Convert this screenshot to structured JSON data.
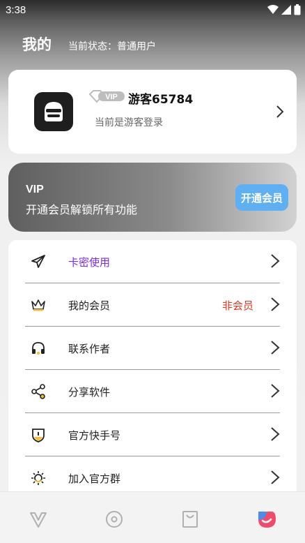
{
  "status_bar": {
    "time": "3:38"
  },
  "header": {
    "title": "我的",
    "status": "当前状态：普通用户"
  },
  "profile": {
    "vip_badge": "VIP",
    "username": "游客65784",
    "login_hint": "当前是游客登录"
  },
  "vip_banner": {
    "title": "VIP",
    "desc": "开通会员解锁所有功能",
    "button": "开通会员"
  },
  "menu": {
    "items": [
      {
        "label": "卡密使用",
        "icon": "paper-plane-icon",
        "highlight": "#7a2cf0"
      },
      {
        "label": "我的会员",
        "icon": "crown-icon",
        "extra": "非会员"
      },
      {
        "label": "联系作者",
        "icon": "headset-icon"
      },
      {
        "label": "分享软件",
        "icon": "share-icon"
      },
      {
        "label": "官方快手号",
        "icon": "shield-icon"
      },
      {
        "label": "加入官方群",
        "icon": "sun-icon"
      }
    ]
  },
  "tabs": [
    {
      "icon": "home-v-icon",
      "active": false
    },
    {
      "icon": "compass-icon",
      "active": false
    },
    {
      "icon": "bag-icon",
      "active": false
    },
    {
      "icon": "profile-icon",
      "active": true
    }
  ],
  "colors": {
    "accent_blue": "#5fb0f2",
    "purple": "#7a2cf0",
    "red": "#e2361e",
    "yellow": "#f2c12e"
  }
}
